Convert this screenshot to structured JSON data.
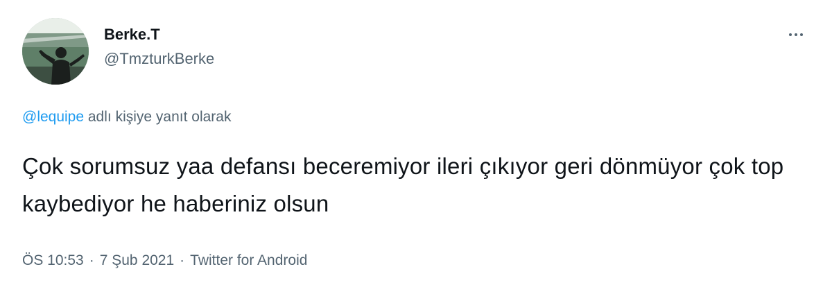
{
  "user": {
    "display_name": "Berke.T",
    "handle": "@TmzturkBerke",
    "avatar_icon": "profile-photo-stadium"
  },
  "reply": {
    "mention": "@lequipe",
    "suffix": " adlı kişiye yanıt olarak"
  },
  "tweet": {
    "text": "Çok sorumsuz yaa defansı beceremiyor ileri çıkıyor geri dönmüyor çok top kaybediyor he haberiniz olsun"
  },
  "meta": {
    "time": "ÖS 10:53",
    "separator": "·",
    "date": "7 Şub 2021",
    "source": "Twitter for Android"
  },
  "colors": {
    "link": "#1d9bf0",
    "secondary_text": "#536471",
    "primary_text": "#0f1419"
  }
}
